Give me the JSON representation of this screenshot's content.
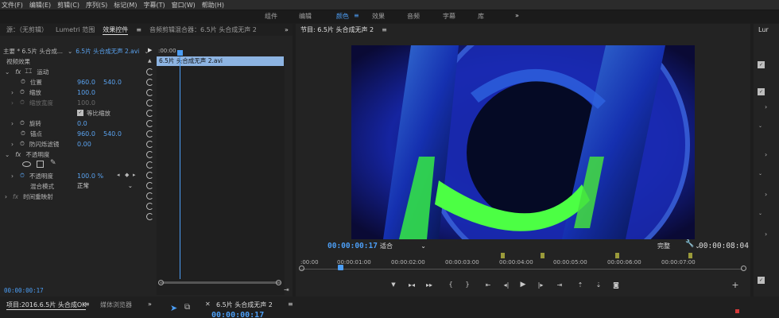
{
  "menu": [
    "文件(F)",
    "编辑(E)",
    "剪辑(C)",
    "序列(S)",
    "标记(M)",
    "字幕(T)",
    "窗口(W)",
    "帮助(H)"
  ],
  "workspaces": [
    "组件",
    "编辑",
    "颜色",
    "效果",
    "音频",
    "字幕",
    "库"
  ],
  "workspace_overflow": "»",
  "effects_panel": {
    "tabs": [
      "源：（无剪辑）",
      "Lumetri 范围",
      "效果控件",
      "音频剪辑混合器：6.5片 头合成无声 2"
    ],
    "master": "主要 * 6.5片 头合成...",
    "clip": "6.5片 头合成无声 2.avi",
    "section_video": "视频效果",
    "motion": "运动",
    "position_label": "位置",
    "position_x": "960.0",
    "position_y": "540.0",
    "scale_label": "缩放",
    "scale_value": "100.0",
    "scale_width_label": "缩放宽度",
    "scale_width_value": "100.0",
    "uniform_label": "等比缩放",
    "rotation_label": "旋转",
    "rotation_value": "0.0",
    "anchor_label": "锚点",
    "anchor_x": "960.0",
    "anchor_y": "540.0",
    "flicker_label": "防闪烁滤镜",
    "flicker_value": "0.00",
    "opacity_section": "不透明度",
    "opacity_label": "不透明度",
    "opacity_value": "100.0 %",
    "blend_label": "混合模式",
    "blend_value": "正常",
    "timeremap": "时间重映射",
    "timeline_clip": "6.5片 头合成无声 2.avi",
    "ruler_start": ":00:00",
    "timecode": "00:00:00:17"
  },
  "program": {
    "title": "节目: 6.5片 头合成无声 2",
    "timecode": "00:00:00:17",
    "fit": "适合",
    "quality": "完整",
    "duration": "00:00:08:04",
    "ruler": [
      ":00:00",
      "00:00:01:00",
      "00:00:02:00",
      "00:00:03:00",
      "00:00:04:00",
      "00:00:05:00",
      "00:00:06:00",
      "00:00:07:00"
    ],
    "playhead_fraction": 0.085
  },
  "lumetri_tab": "Lur",
  "project": {
    "tabs": [
      "项目:2016.6.5片 头合成OK",
      "媒体浏览器"
    ],
    "sequence_tab": "6.5片 头合成无声 2",
    "timecode": "00:00:00:17"
  },
  "colors": {
    "accent": "#4c9ef5",
    "clip": "#8db4e2",
    "bg": "#232323"
  }
}
